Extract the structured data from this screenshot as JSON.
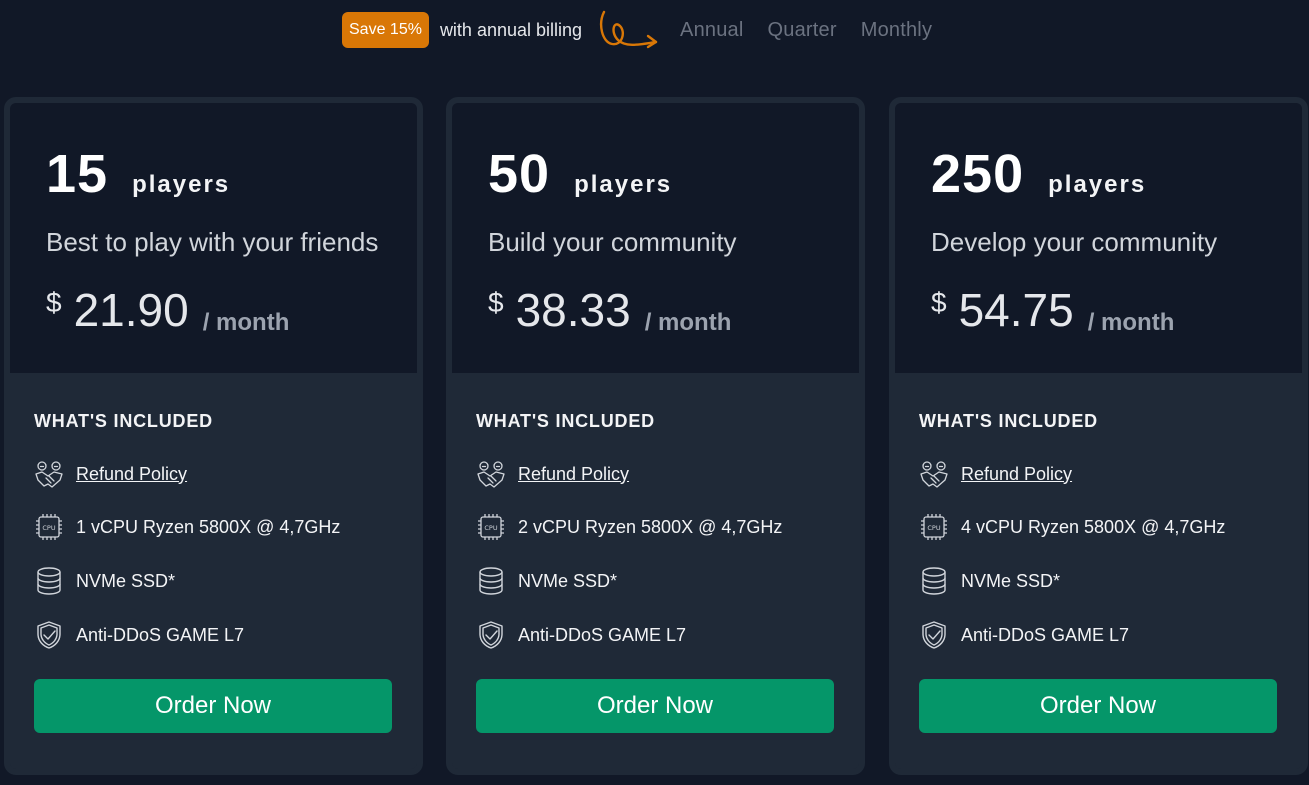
{
  "billing": {
    "save_badge": "Save 15%",
    "note": "with annual billing",
    "tabs": [
      "Annual",
      "Quarter",
      "Monthly"
    ]
  },
  "plans": [
    {
      "count": "15",
      "unit": "players",
      "tagline": "Best to play with your friends",
      "currency": "$",
      "price": "21.90",
      "period": "/ month",
      "included_title": "WHAT'S INCLUDED",
      "features": [
        "Refund Policy",
        "1 vCPU Ryzen 5800X @ 4,7GHz",
        "NVMe SSD*",
        "Anti-DDoS GAME L7"
      ],
      "cta": "Order Now"
    },
    {
      "count": "50",
      "unit": "players",
      "tagline": "Build your community",
      "currency": "$",
      "price": "38.33",
      "period": "/ month",
      "included_title": "WHAT'S INCLUDED",
      "features": [
        "Refund Policy",
        "2 vCPU Ryzen 5800X @ 4,7GHz",
        "NVMe SSD*",
        "Anti-DDoS GAME L7"
      ],
      "cta": "Order Now"
    },
    {
      "count": "250",
      "unit": "players",
      "tagline": "Develop your community",
      "currency": "$",
      "price": "54.75",
      "period": "/ month",
      "included_title": "WHAT'S INCLUDED",
      "features": [
        "Refund Policy",
        "4 vCPU Ryzen 5800X @ 4,7GHz",
        "NVMe SSD*",
        "Anti-DDoS GAME L7"
      ],
      "cta": "Order Now"
    }
  ],
  "icons": {
    "refund": "handshake-icon",
    "cpu": "cpu-icon",
    "storage": "database-icon",
    "security": "shield-check-icon",
    "arrow": "curly-arrow-icon"
  },
  "colors": {
    "background": "#111827",
    "card": "#1f2937",
    "accent_badge": "#d97706",
    "button": "#059669",
    "tab_inactive": "#6b7280"
  }
}
